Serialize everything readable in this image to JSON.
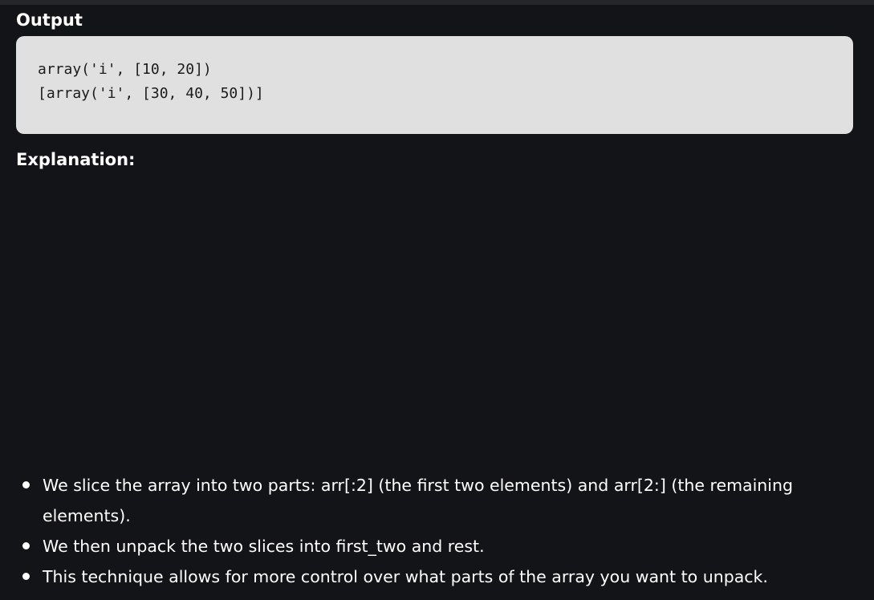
{
  "output_heading": "Output",
  "code_lines": [
    "array('i', [10, 20])",
    "[array('i', [30, 40, 50])]"
  ],
  "explanation_heading": "Explanation:",
  "bullets": [
    "We slice the array into two parts: arr[:2] (the first two elements) and arr[2:] (the remaining elements).",
    "We then unpack the two slices into first_two and rest.",
    "This technique allows for more control over what parts of the array you want to unpack."
  ],
  "colors": {
    "background": "#131417",
    "code_background": "#e0e0e0",
    "text": "#ffffff",
    "code_text": "#1b1b1b"
  }
}
